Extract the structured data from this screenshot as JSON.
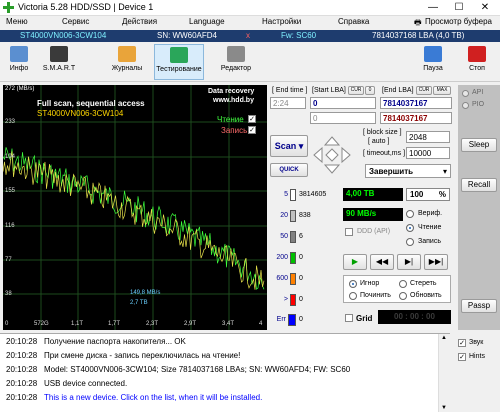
{
  "title": "Victoria 5.28 HDD/SSD | Device 1",
  "menu": [
    "Меню",
    "Сервис",
    "Действия",
    "Language",
    "Настройки",
    "Справка",
    "Просмотр буфера"
  ],
  "device": {
    "model": "ST4000VN006-3CW104",
    "sn": "SN: WW60AFD4",
    "x": "x",
    "fw": "Fw: SC60",
    "lba": "7814037168 LBA (4,0 TB)"
  },
  "toolbar": {
    "info": "Инфо",
    "smart": "S.M.A.R.T",
    "journals": "Журналы",
    "testing": "Тестирование",
    "editor": "Редактор",
    "pause": "Пауза",
    "stop": "Стоп"
  },
  "graph": {
    "ymax": "272 (MB/s)",
    "ticks_y": [
      "233",
      "194",
      "155",
      "116",
      "77",
      "38"
    ],
    "ticks_x": [
      "0",
      "572G",
      "1,1T",
      "1,7T",
      "2,3T",
      "2,9T",
      "3,4T",
      "4"
    ],
    "title": "Full scan, sequential access",
    "model": "ST4000VN006-3CW104",
    "wm1": "Data recovery",
    "wm2": "www.hdd.by",
    "read": "Чтение",
    "write": "Запись",
    "speed": "149,8 MB/s",
    "size": "2,7 TB"
  },
  "controls": {
    "end_time_label": "[ End time ]",
    "end_time": "2:24",
    "start_lba_label": "[Start LBA]",
    "cur_label": "CUR",
    "zero_label": "0",
    "start_lba": "0",
    "start_lba2": "0",
    "end_lba_label": "[End LBA]",
    "max_label": "MAX",
    "end_lba": "7814037167",
    "end_lba2": "7814037167",
    "scan": "Scan",
    "quick": "QUICK",
    "block_size_label": "[ block size ]",
    "auto_label": "[ auto ]",
    "block_size": "2048",
    "timeout_label": "[ timeout,ms ]",
    "timeout": "10000",
    "finish": "Завершить"
  },
  "counters": [
    {
      "label": "5",
      "value": "3814605",
      "color": "#ffffff"
    },
    {
      "label": "20",
      "value": "838",
      "color": "#c0c0c0"
    },
    {
      "label": "50",
      "value": "6",
      "color": "#808080"
    },
    {
      "label": "200",
      "value": "0",
      "color": "#00c000"
    },
    {
      "label": "600",
      "value": "0",
      "color": "#ff8000"
    },
    {
      "label": ">",
      "value": "0",
      "color": "#ff0000"
    },
    {
      "label": "Err",
      "value": "0",
      "color": "#0000ff"
    }
  ],
  "status": {
    "size": "4,00 TB",
    "percent": "100",
    "pct_sign": "%",
    "speed": "90 MB/s",
    "ddd": "DDD (API)",
    "verify": "Вериф.",
    "read": "Чтение",
    "write": "Запись",
    "ignore": "Игнор",
    "erase": "Стереть",
    "repair": "Починить",
    "update": "Обновить",
    "grid": "Grid",
    "timer": "00 : 00 : 00"
  },
  "right": {
    "api": "API",
    "pio": "PIO",
    "sleep": "Sleep",
    "recall": "Recall",
    "passp": "Passp"
  },
  "log": [
    {
      "t": "20:10:28",
      "msg": "Получение паспорта накопителя... OK",
      "color": "#000000"
    },
    {
      "t": "20:10:28",
      "msg": "При смене диска - запись переключилась на чтение!",
      "color": "#000000"
    },
    {
      "t": "20:10:28",
      "msg": "Model: ST4000VN006-3CW104; Size 7814037168 LBAs; SN: WW60AFD4; FW: SC60",
      "color": "#000000"
    },
    {
      "t": "20:10:28",
      "msg": "USB device connected.",
      "color": "#000000"
    },
    {
      "t": "20:10:28",
      "msg": "This is a new device. Click on the list, when it will be installed.",
      "color": "#0000ff"
    }
  ],
  "log_side": {
    "sound": "Звук",
    "hints": "Hints"
  }
}
